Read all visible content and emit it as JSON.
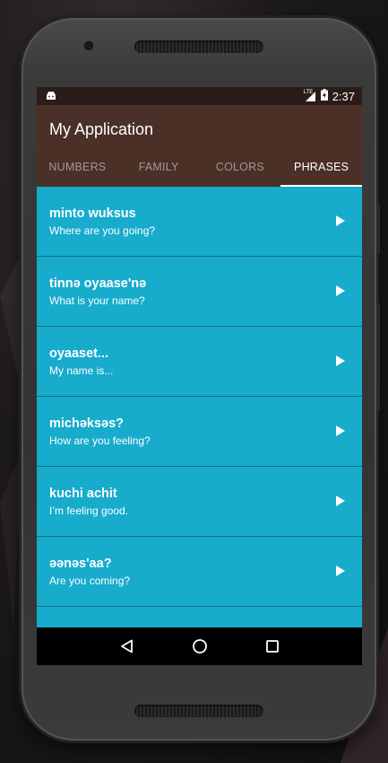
{
  "status_bar": {
    "time": "2:37",
    "network": "LTE"
  },
  "app": {
    "title": "My Application"
  },
  "tabs": [
    {
      "label": "NUMBERS"
    },
    {
      "label": "FAMILY"
    },
    {
      "label": "COLORS"
    },
    {
      "label": "PHRASES",
      "active": true
    }
  ],
  "phrases": [
    {
      "miwok": "minto wuksus",
      "english": "Where are you going?"
    },
    {
      "miwok": "tinnə oyaase'nə",
      "english": "What is your name?"
    },
    {
      "miwok": "oyaaset...",
      "english": "My name is..."
    },
    {
      "miwok": "michəksəs?",
      "english": "How are you feeling?"
    },
    {
      "miwok": "kuchi achit",
      "english": "I’m feeling good."
    },
    {
      "miwok": "əənəs'aa?",
      "english": "Are you coming?"
    }
  ],
  "colors": {
    "status_bar": "#2a1d19",
    "app_bar": "#4a3026",
    "list_background": "#17abcc",
    "row_divider": "#0e7086"
  }
}
